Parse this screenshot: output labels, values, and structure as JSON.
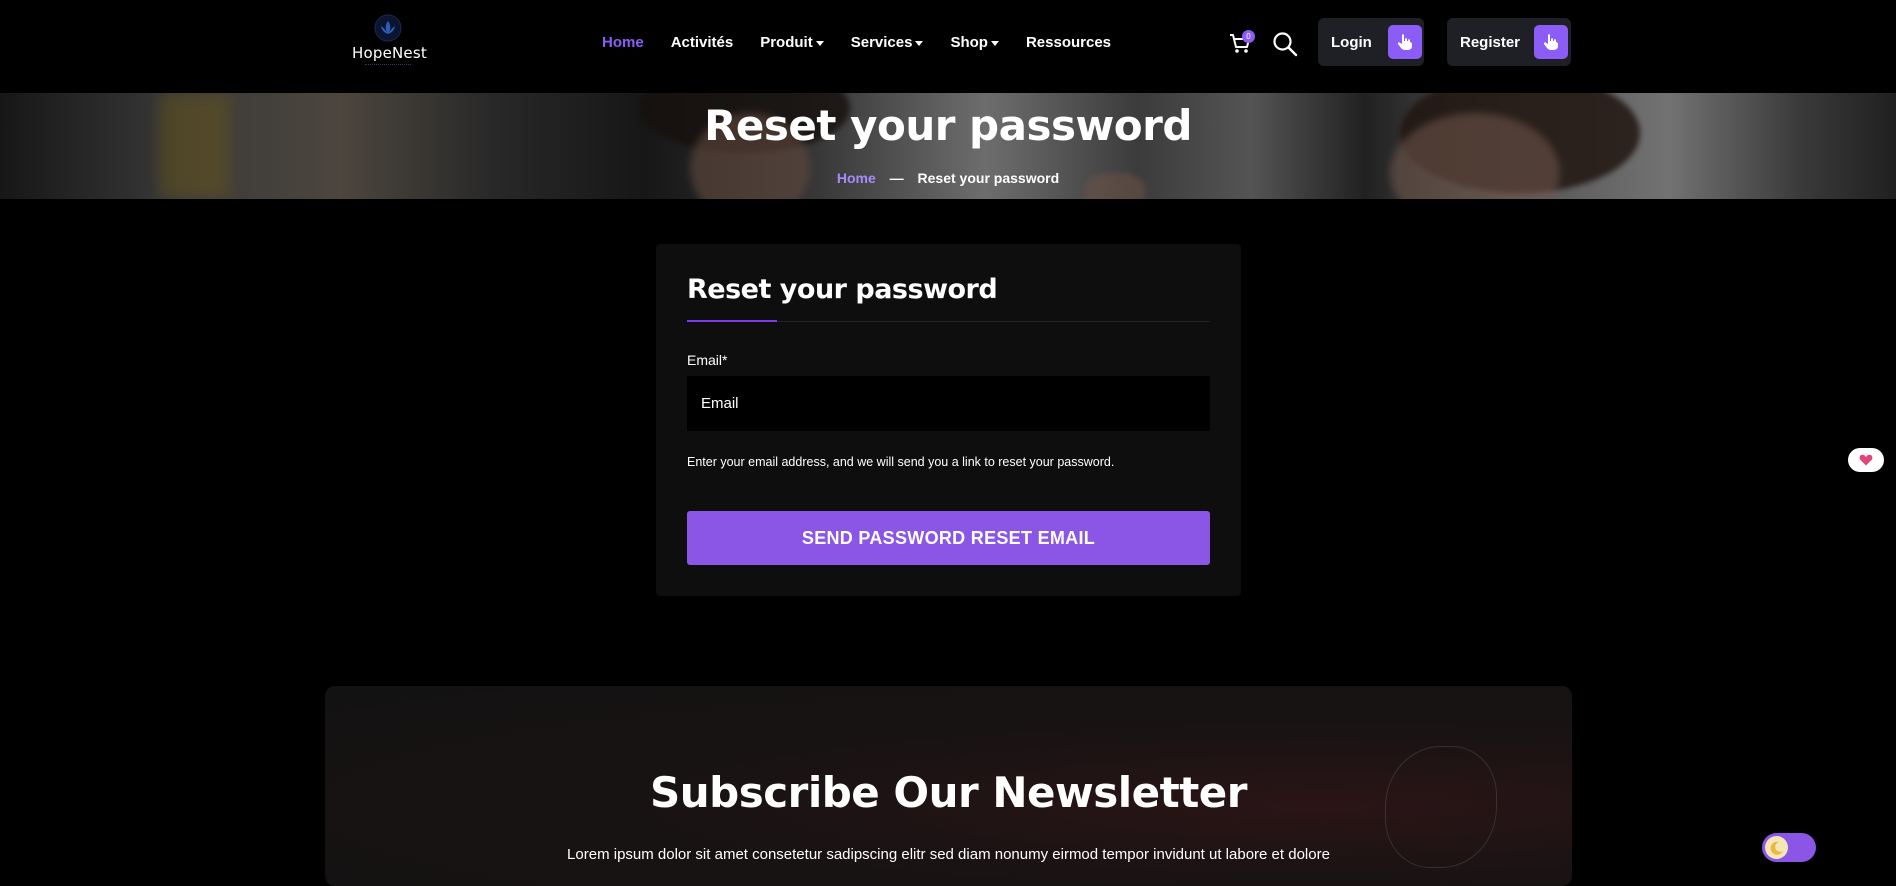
{
  "header": {
    "logo_text": "HopeNest",
    "nav": [
      {
        "label": "Home",
        "active": true,
        "dropdown": false
      },
      {
        "label": "Activités",
        "active": false,
        "dropdown": false
      },
      {
        "label": "Produit",
        "active": false,
        "dropdown": true
      },
      {
        "label": "Services",
        "active": false,
        "dropdown": true
      },
      {
        "label": "Shop",
        "active": false,
        "dropdown": true
      },
      {
        "label": "Ressources",
        "active": false,
        "dropdown": false
      }
    ],
    "cart_count": "0",
    "login_label": "Login",
    "register_label": "Register"
  },
  "banner": {
    "title": "Reset your password",
    "breadcrumb_home": "Home",
    "breadcrumb_sep": "—",
    "breadcrumb_current": "Reset your password"
  },
  "form": {
    "title": "Reset your password",
    "email_label": "Email*",
    "email_placeholder": "Email",
    "email_value": "",
    "help_text": "Enter your email address, and we will send you a link to reset your password.",
    "submit_label": "SEND PASSWORD RESET EMAIL"
  },
  "newsletter": {
    "title": "Subscribe Our Newsletter",
    "text": "Lorem ipsum dolor sit amet consetetur sadipscing elitr sed diam nonumy eirmod tempor invidunt ut labore et dolore"
  },
  "icons": {
    "logo": "lotus-icon",
    "cart": "cart-icon",
    "search": "search-icon",
    "login": "pointer-hand-icon",
    "register": "pointer-hand-icon",
    "floating": "heart-icon",
    "theme": "moon-icon"
  },
  "colors": {
    "accent": "#8b55e6",
    "background": "#000000",
    "card": "#0e0e0f"
  }
}
